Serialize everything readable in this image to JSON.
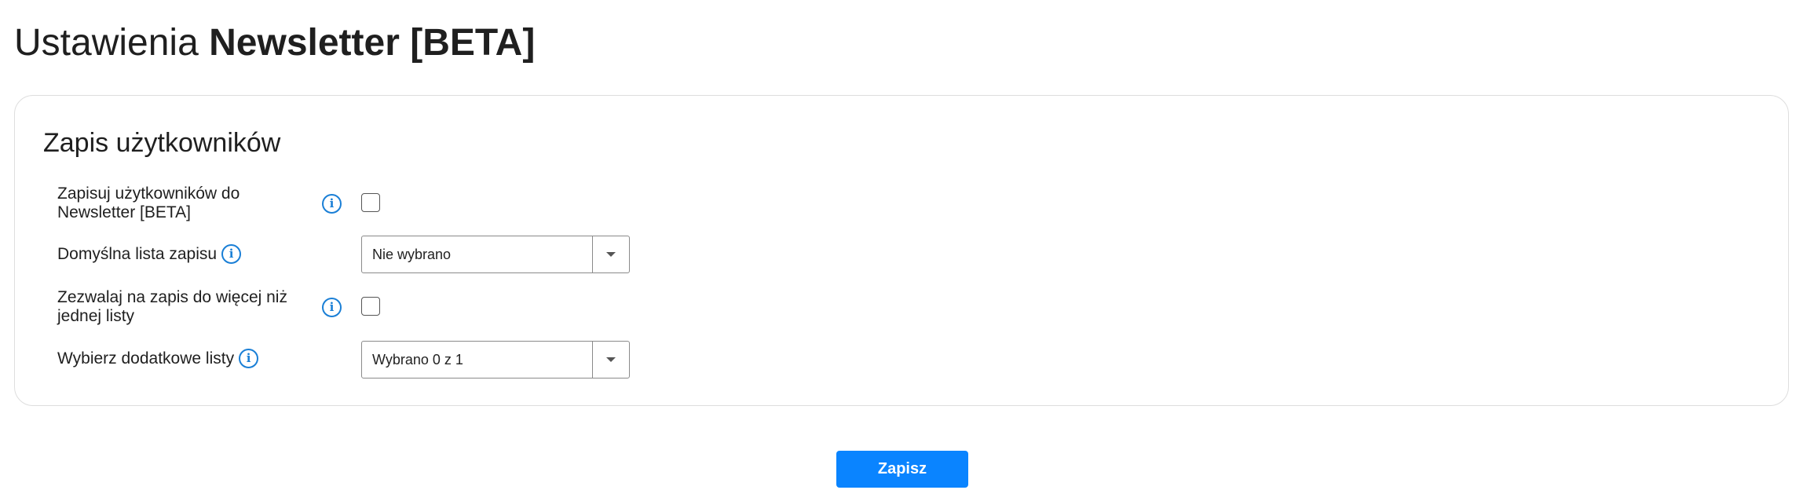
{
  "page": {
    "title_prefix": "Ustawienia",
    "title_strong": "Newsletter [BETA]"
  },
  "section": {
    "title": "Zapis użytkowników",
    "fields": [
      {
        "label_line1": "Zapisuj użytkowników do",
        "label_line2": "Newsletter [BETA]",
        "control": "checkbox",
        "checked": false,
        "info_icon": "info-icon"
      },
      {
        "label": "Domyślna lista zapisu",
        "control": "select",
        "value": "Nie wybrano",
        "info_icon": "info-icon",
        "dropdown_icon": "chevron-down-icon"
      },
      {
        "label_line1": "Zezwalaj na zapis do więcej niż",
        "label_line2": "jednej listy",
        "control": "checkbox",
        "checked": false,
        "info_icon": "info-icon"
      },
      {
        "label": "Wybierz dodatkowe listy",
        "control": "select",
        "value": "Wybrano 0 z 1",
        "info_icon": "info-icon",
        "dropdown_icon": "chevron-down-icon"
      }
    ]
  },
  "actions": {
    "save_label": "Zapisz"
  },
  "colors": {
    "accent": "#0a84ff",
    "info": "#1a7fd6",
    "text": "#1f1f1f",
    "border": "#dedede"
  }
}
